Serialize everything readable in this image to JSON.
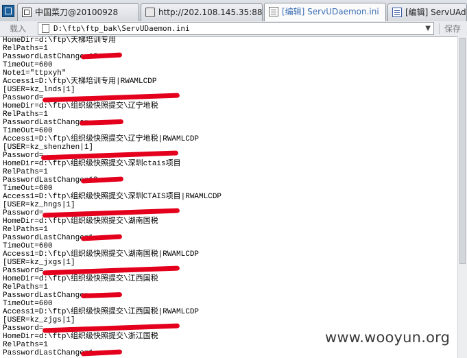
{
  "tabs": [
    {
      "label": "中国菜刀@20100928",
      "icon": "window-icon"
    },
    {
      "label": "http://202.108.145.35:8888/i...",
      "icon": "folder-icon"
    },
    {
      "label": "[编辑] ServUDaemon.ini",
      "icon": "document-icon"
    },
    {
      "label": "[编辑] ServUAdmin",
      "icon": "document-icon"
    }
  ],
  "toolbar": {
    "load_label": "载入",
    "path": "D:\\ftp\\ftp_bak\\ServUDaemon.ini",
    "save_label": "保存"
  },
  "file_lines": [
    "HomeDir=d:\\ftp\\天梯培训专用",
    "RelPaths=1",
    "PasswordLastChange=12",
    "TimeOut=600",
    "Note1=\"ttpxyh\"",
    "Access1=D:\\ftp\\天梯培训专用|RWAMLCDP",
    "[USER=kz_lnds|1]",
    "Password=",
    "HomeDir=d:\\ftp\\组织级快照提交\\辽宁地税",
    "RelPaths=1",
    "PasswordLastChange=",
    "TimeOut=600",
    "Access1=D:\\ftp\\组织级快照提交\\辽宁地税|RWAMLCDP",
    "[USER=kz_shenzhen|1]",
    "Password=",
    "HomeDir=d:\\ftp\\组织级快照提交\\深圳ctais项目",
    "RelPaths=1",
    "PasswordLastChange=12",
    "TimeOut=600",
    "Access1=D:\\ftp\\组织级快照提交\\深圳CTAIS项目|RWAMLCDP",
    "[USER=kz_hngs|1]",
    "Password=",
    "HomeDir=d:\\ftp\\组织级快照提交\\湖南国税",
    "RelPaths=1",
    "PasswordLastChange=1",
    "TimeOut=600",
    "Access1=D:\\ftp\\组织级快照提交\\湖南国税|RWAMLCDP",
    "[USER=kz_jxgs|1]",
    "Password=",
    "HomeDir=d:\\ftp\\组织级快照提交\\江西国税",
    "RelPaths=1",
    "PasswordLastChange=",
    "TimeOut=600",
    "Access1=D:\\ftp\\组织级快照提交\\江西国税|RWAMLCDP",
    "[USER=kz_zjgs|1]",
    "Password=",
    "HomeDir=d:\\ftp\\组织级快照提交\\浙江国税",
    "RelPaths=1",
    "PasswordLastChange=1"
  ],
  "watermark": "www.wooyun.org",
  "colors": {
    "redaction": "#e4001c",
    "active_tab_text": "#3b6fb3"
  }
}
